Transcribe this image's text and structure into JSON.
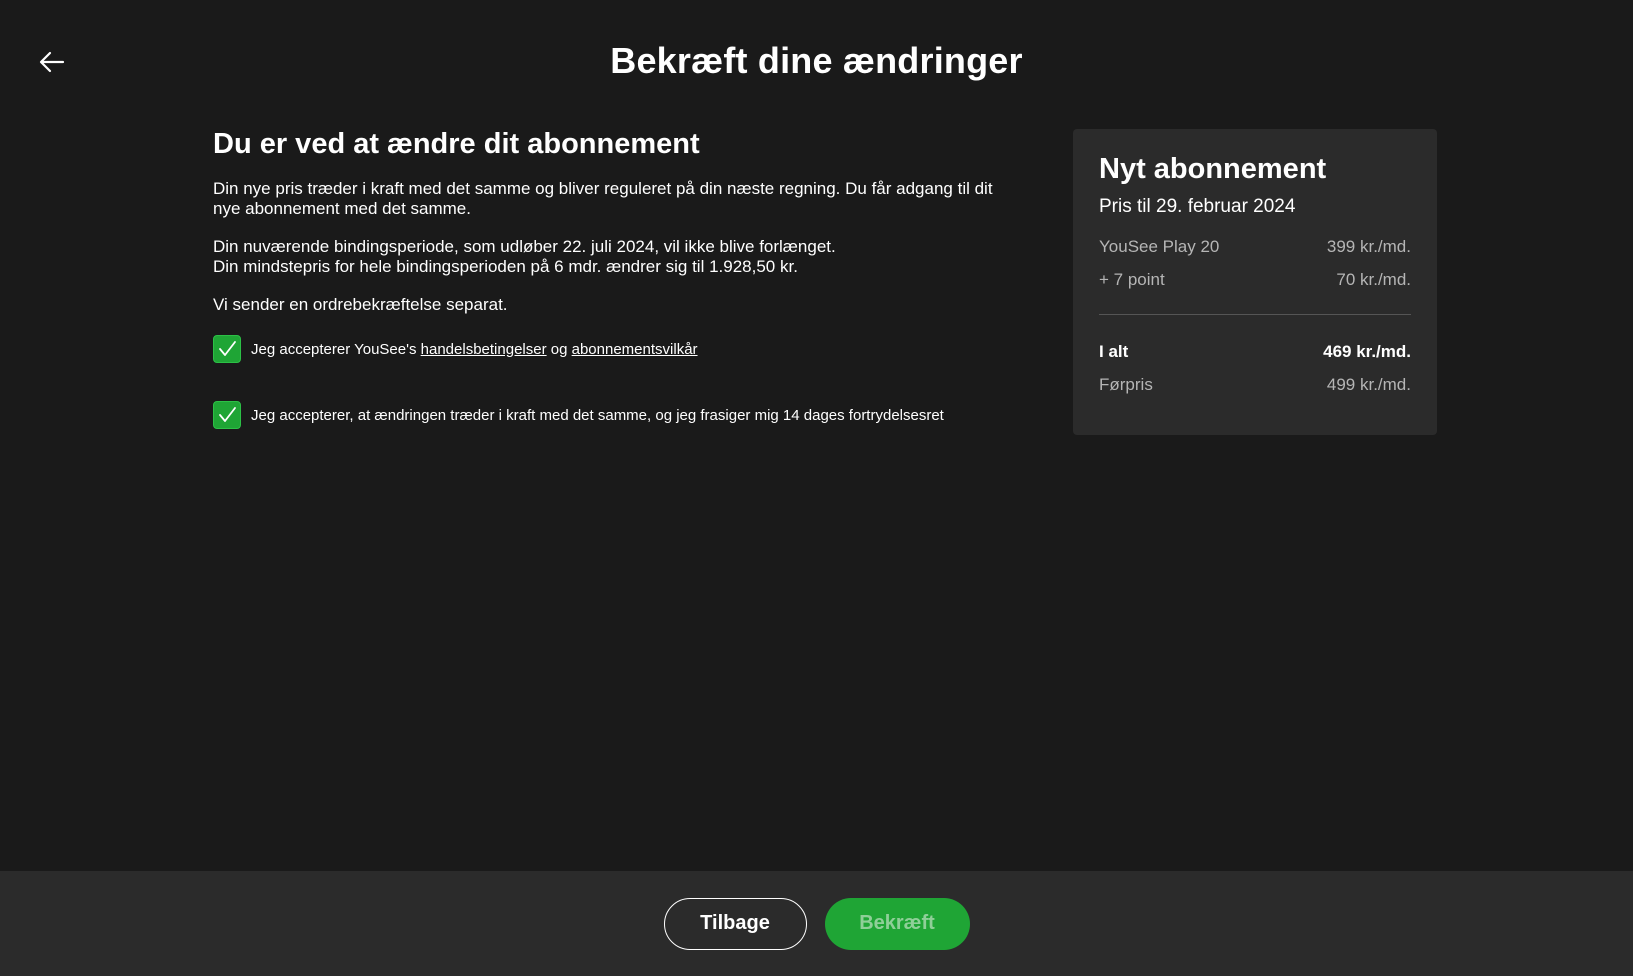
{
  "header": {
    "title": "Bekræft dine ændringer"
  },
  "main": {
    "heading": "Du er ved at ændre dit abonnement",
    "paragraph1": "Din nye pris træder i kraft med det samme og bliver reguleret på din næste regning. Du får adgang til dit nye abonnement med det samme.",
    "paragraph2_line1": "Din nuværende bindingsperiode, som udløber 22. juli 2024, vil ikke blive forlænget.",
    "paragraph2_line2": "Din mindstepris for hele bindingsperioden på 6 mdr. ændrer sig til 1.928,50 kr.",
    "paragraph3": "Vi sender en ordrebekræftelse separat.",
    "checkbox1": {
      "checked": true,
      "text_prefix": "Jeg accepterer YouSee's ",
      "link1": "handelsbetingelser",
      "text_middle": " og ",
      "link2": "abonnementsvilkår"
    },
    "checkbox2": {
      "checked": true,
      "text": "Jeg accepterer, at ændringen træder i kraft med det samme, og jeg frasiger mig 14 dages fortrydelsesret"
    }
  },
  "summary": {
    "title": "Nyt abonnement",
    "subtitle": "Pris til 29. februar 2024",
    "items": [
      {
        "label": "YouSee Play 20",
        "price": "399 kr./md."
      },
      {
        "label": "+ 7 point",
        "price": "70 kr./md."
      }
    ],
    "total": {
      "label": "I alt",
      "price": "469 kr./md."
    },
    "previous": {
      "label": "Førpris",
      "price": "499 kr./md."
    }
  },
  "footer": {
    "back_label": "Tilbage",
    "confirm_label": "Bekræft"
  },
  "colors": {
    "background": "#1a1a1a",
    "card": "#2b2b2b",
    "accent_green": "#1fa535"
  },
  "icons": {
    "back": "arrow-left-icon",
    "check": "checkmark-icon"
  }
}
